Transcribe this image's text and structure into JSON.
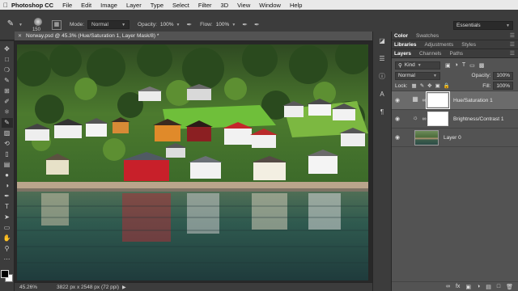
{
  "menubar": {
    "apple": "",
    "items": [
      "Photoshop CC",
      "File",
      "Edit",
      "Image",
      "Layer",
      "Type",
      "Select",
      "Filter",
      "3D",
      "View",
      "Window",
      "Help"
    ]
  },
  "options": {
    "brush_size": "150",
    "mode_label": "Mode:",
    "mode_value": "Normal",
    "opacity_label": "Opacity:",
    "opacity_value": "100%",
    "flow_label": "Flow:",
    "flow_value": "100%",
    "workspace": "Essentials"
  },
  "document": {
    "tab_title": "Norway.psd @ 45.3% (Hue/Saturation 1, Layer Mask/8) *",
    "zoom": "45.26%",
    "doc_info": "3822 px x 2548 px (72 ppi)"
  },
  "panels": {
    "top_tabs": [
      "Color",
      "Swatches"
    ],
    "mid_tabs": [
      "Libraries",
      "Adjustments",
      "Styles"
    ],
    "layer_tabs": [
      "Layers",
      "Channels",
      "Paths"
    ],
    "kind_label": "Kind",
    "blend_mode": "Normal",
    "opacity_label": "Opacity:",
    "opacity_value": "100%",
    "lock_label": "Lock:",
    "fill_label": "Fill:",
    "fill_value": "100%"
  },
  "layers": [
    {
      "name": "Hue/Saturation 1",
      "type": "adjustment",
      "selected": true
    },
    {
      "name": "Brightness/Contrast 1",
      "type": "adjustment",
      "selected": false
    },
    {
      "name": "Layer 0",
      "type": "pixel",
      "selected": false
    }
  ],
  "colors": {
    "accent": "#3c3c3c",
    "panel": "#535353",
    "selected_layer": "#6b6b6b"
  }
}
